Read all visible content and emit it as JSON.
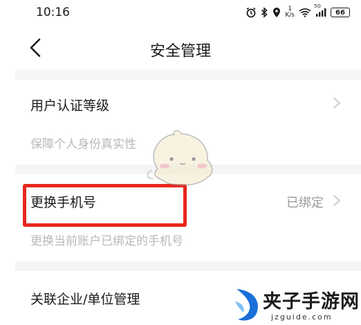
{
  "status_bar": {
    "time": "10:16",
    "net_speed_value": "1",
    "net_speed_unit": "K/s",
    "network_type": "5G",
    "battery": "66"
  },
  "nav": {
    "title": "安全管理"
  },
  "settings": [
    {
      "title": "用户认证等级",
      "subtitle": "保障个人身份真实性",
      "value": ""
    },
    {
      "title": "更换手机号",
      "subtitle": "更换当前账户已绑定的手机号",
      "value": "已绑定"
    },
    {
      "title": "关联企业/单位管理",
      "subtitle": "",
      "value": ""
    }
  ],
  "watermark": {
    "site_name": "夹子手游网",
    "url": "jzguide.com"
  },
  "colors": {
    "highlight_border": "#e8261c",
    "divider": "#f5f5f7",
    "subtitle_text": "#b8b8b8",
    "watermark_icon": "#1a6fd8"
  }
}
